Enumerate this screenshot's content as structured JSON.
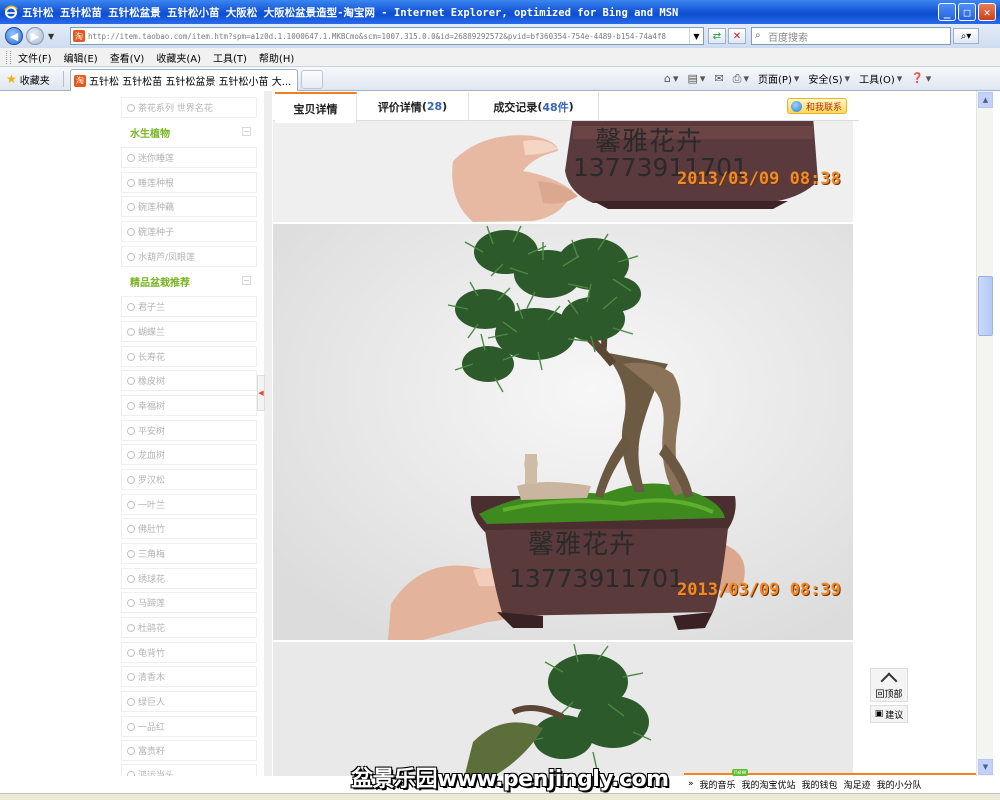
{
  "window": {
    "title": "五针松 五针松苗 五针松盆景 五针松小苗 大阪松 大阪松盆景造型-淘宝网 - Internet Explorer, optimized for Bing and MSN"
  },
  "address": {
    "url": "http://item.taobao.com/item.htm?spm=a1z0d.1.1000647.1.MKBCmo&scm=1007.315.0.0&id=26889292572&pvid=bf360354-754e-4489-b154-74a4f8",
    "search_placeholder": "百度搜索"
  },
  "menu": [
    "文件(F)",
    "编辑(E)",
    "查看(V)",
    "收藏夹(A)",
    "工具(T)",
    "帮助(H)"
  ],
  "favorites": {
    "label": "收藏夹",
    "tab_title": "五针松 五针松苗 五针松盆景 五针松小苗 大..."
  },
  "command_bar": {
    "page": "页面(P)",
    "safety": "安全(S)",
    "tools": "工具(O)"
  },
  "sidebar": {
    "items_top": [
      "茶花系列 世界名花"
    ],
    "cat_water": "水生植物",
    "water_items": [
      "迷你睡莲",
      "睡莲种根",
      "碗莲种藕",
      "碗莲种子",
      "水葫芦/凤眼莲"
    ],
    "cat_featured": "精品盆栽推荐",
    "featured_items": [
      "君子兰",
      "蝴蝶兰",
      "长寿花",
      "橡皮树",
      "幸福树",
      "平安树",
      "龙血树",
      "罗汉松",
      "一叶兰",
      "佛肚竹",
      "三角梅",
      "绣球花",
      "马蹄莲",
      "杜鹃花",
      "龟背竹",
      "清香木",
      "绿巨人",
      "一品红",
      "富贵籽",
      "鸿运当头"
    ],
    "collapse_symbol": "−"
  },
  "detail_tabs": [
    {
      "label": "宝贝详情",
      "count": ""
    },
    {
      "label": "评价详情",
      "count": "28"
    },
    {
      "label": "成交记录",
      "count": "48件"
    }
  ],
  "contact_button": "和我联系",
  "photos": {
    "shop_name": "馨雅花卉",
    "phone": "13773911701",
    "stamp1": "2013/03/09 08:38",
    "stamp2": "2013/03/09 08:39"
  },
  "float_buttons": {
    "back_top": "回顶部",
    "suggest": "建议"
  },
  "bottom_toolbar": [
    "我的音乐",
    "我的淘宝优站",
    "我的钱包",
    "淘足迹",
    "我的小分队"
  ],
  "site_watermark": "盆景乐园www.penjingly.com",
  "colors": {
    "accent_orange": "#f27c1e",
    "category_green": "#78b424",
    "count_blue": "#3765b5"
  }
}
